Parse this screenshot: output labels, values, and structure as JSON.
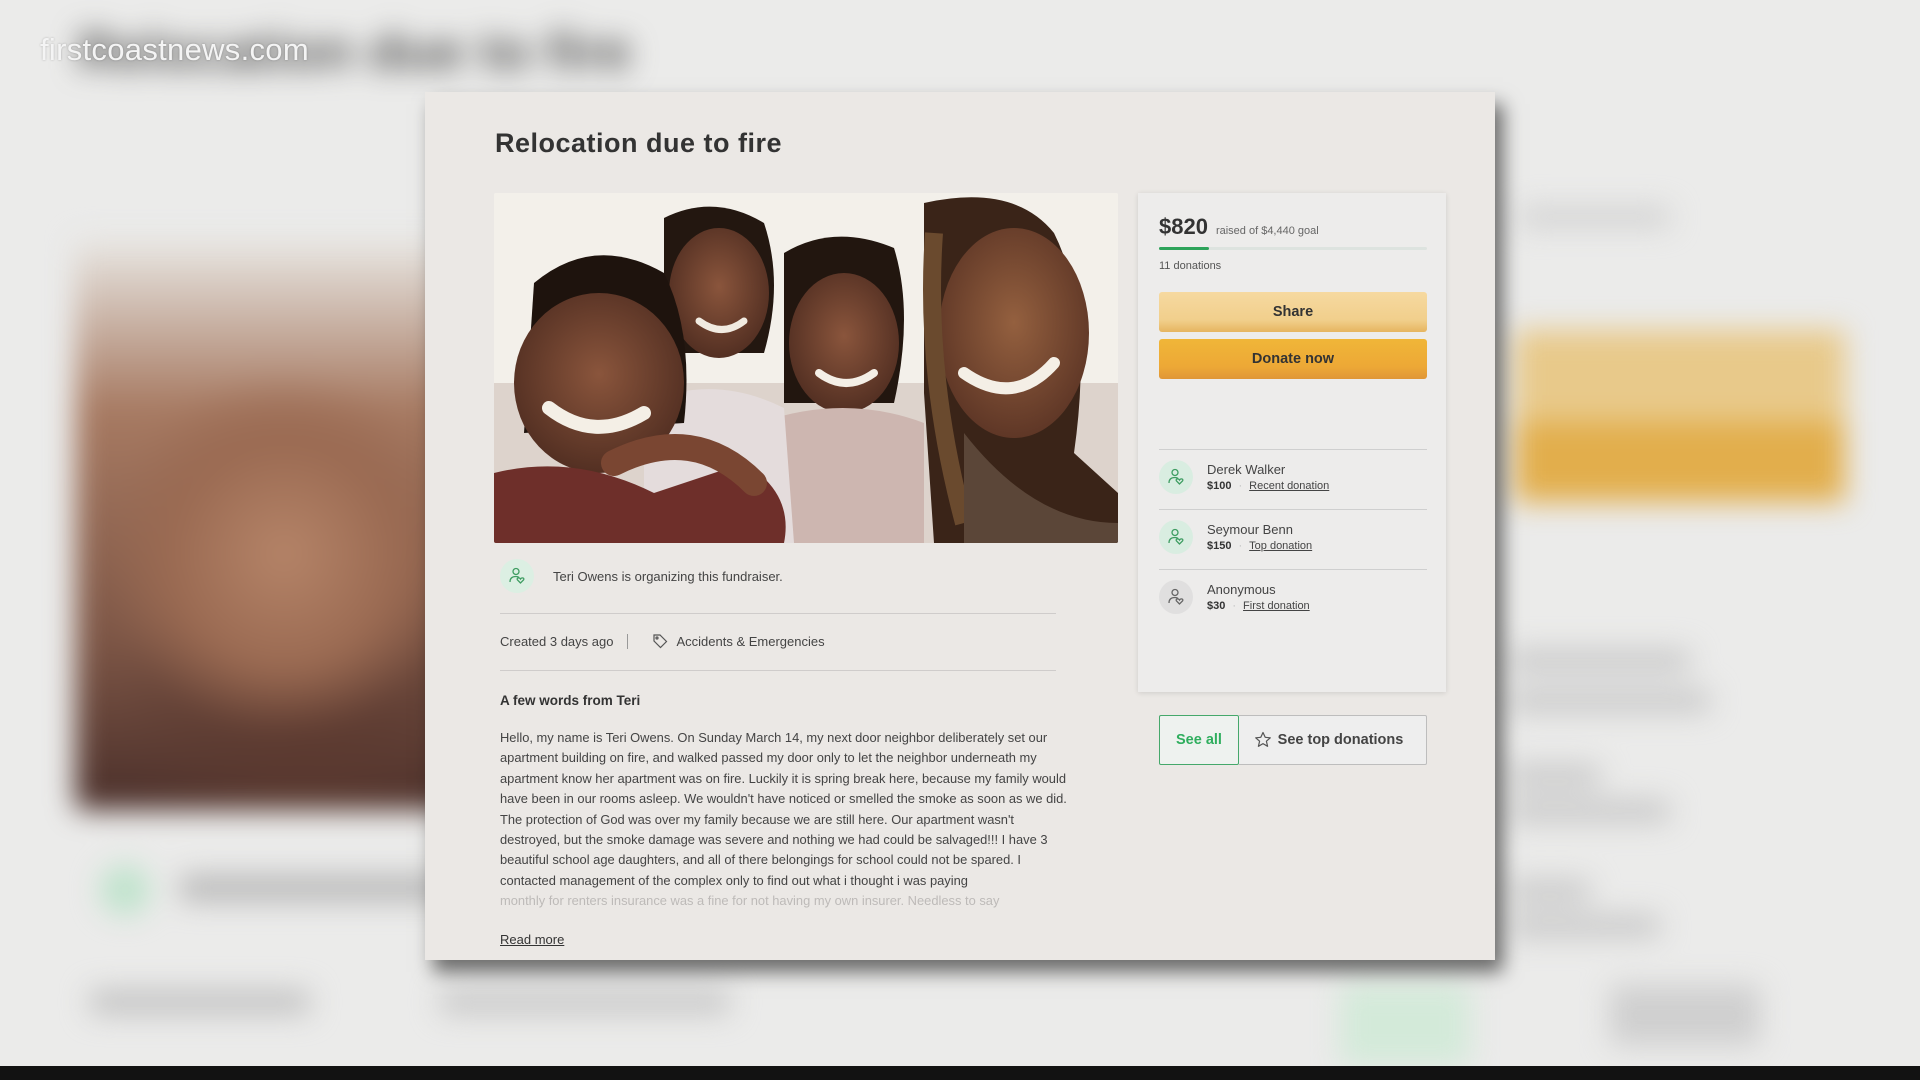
{
  "watermark": "firstcoastnews.com",
  "background_title": "Relocation due to fire",
  "campaign": {
    "title": "Relocation due to fire",
    "photo_alt": "Selfie of a smiling mother with her three daughters",
    "organizer_text": "Teri Owens is organizing this fundraiser.",
    "created": "Created 3 days ago",
    "category": "Accidents & Emergencies",
    "story_heading": "A few words from Teri",
    "story_paragraphs": [
      "Hello, my name is Teri Owens. On Sunday March 14, my next door neighbor deliberately set our apartment building on fire, and walked passed my door only to let the neighbor underneath my apartment know her apartment was on fire. Luckily it is spring break here, because my family would have been in our rooms asleep. We wouldn't have noticed or smelled the smoke as soon as we did.",
      "The protection of God was over my family because we are still here. Our apartment wasn't destroyed, but the smoke damage was severe and nothing we had could be salvaged!!! I have 3 beautiful school age daughters, and all of there belongings for school could not be spared. I contacted management of the complex only to find out what i thought i was paying"
    ],
    "story_faded_line": "monthly for renters insurance was a fine for not having my own insurer. Needless to say",
    "read_more": "Read more"
  },
  "donation_panel": {
    "raised_amount": "$820",
    "goal_text": "raised of $4,440 goal",
    "progress_percent": 18.5,
    "donation_count": "11 donations",
    "share_label": "Share",
    "donate_label": "Donate now",
    "donors": [
      {
        "name": "Derek Walker",
        "amount": "$100",
        "label": "Recent donation",
        "icon": "donor-heart-icon"
      },
      {
        "name": "Seymour Benn",
        "amount": "$150",
        "label": "Top donation",
        "icon": "donor-heart-icon"
      },
      {
        "name": "Anonymous",
        "amount": "$30",
        "label": "First donation",
        "icon": "donor-heart-icon"
      }
    ],
    "see_all_label": "See all",
    "see_top_label": "See top donations"
  },
  "colors": {
    "accent_green": "#2da35a",
    "share_yellow": "#f1cf8c",
    "donate_orange": "#eda836"
  }
}
